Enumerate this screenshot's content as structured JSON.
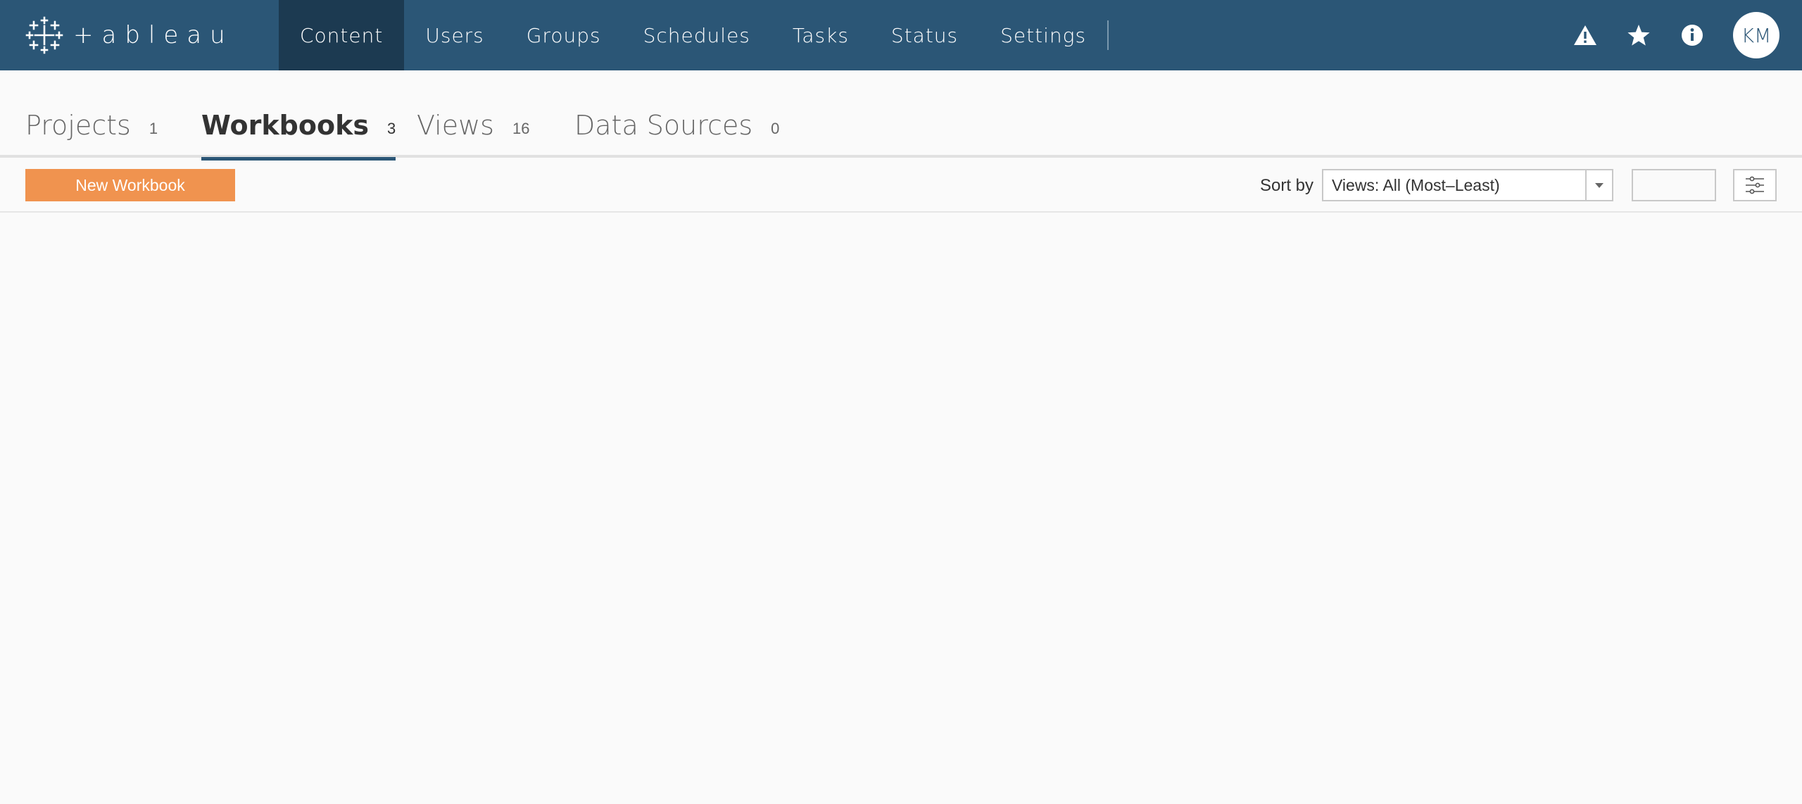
{
  "brand": {
    "name": "+ableau",
    "icon": "tableau-logo-icon"
  },
  "nav": {
    "items": [
      {
        "label": "Content",
        "active": true
      },
      {
        "label": "Users",
        "active": false
      },
      {
        "label": "Groups",
        "active": false
      },
      {
        "label": "Schedules",
        "active": false
      },
      {
        "label": "Tasks",
        "active": false
      },
      {
        "label": "Status",
        "active": false
      },
      {
        "label": "Settings",
        "active": false
      }
    ]
  },
  "top_right": {
    "icons": [
      "alert-icon",
      "star-icon",
      "info-icon"
    ],
    "avatar_initials": "KM"
  },
  "tabs": [
    {
      "label": "Projects",
      "count": "1",
      "active": false
    },
    {
      "label": "Workbooks",
      "count": "3",
      "active": true
    },
    {
      "label": "Views",
      "count": "16",
      "active": false
    },
    {
      "label": "Data Sources",
      "count": "0",
      "active": false
    }
  ],
  "toolbar": {
    "new_button_label": "New Workbook",
    "sort_label": "Sort by",
    "sort_value": "Views: All (Most–Least)",
    "settings_icon": "sliders-icon"
  },
  "colors": {
    "topbar": "#2b5676",
    "nav_active": "#1c3a51",
    "accent_button": "#f0934f",
    "tab_underline": "#2b5676"
  }
}
